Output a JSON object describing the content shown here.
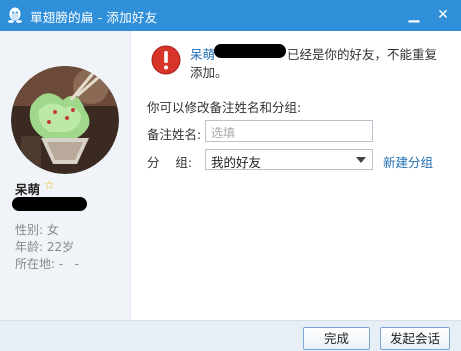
{
  "window": {
    "title": "單翅膀的扁 - 添加好友",
    "controls": {
      "minimize": "▁",
      "close": "✕"
    }
  },
  "profile": {
    "name": "呆萌",
    "gender": "性别: 女",
    "age": "年龄: 22岁",
    "location": "所在地: -   -"
  },
  "message": {
    "nickname": "呆萌",
    "line1_suffix": "已经是你的好友，不能重复",
    "line2": "添加。"
  },
  "form": {
    "hint": "你可以修改备注姓名和分组:",
    "remark_label": "备注姓名:",
    "remark_placeholder": "选填",
    "group_label": "分    组:",
    "group_value": "我的好友",
    "new_group_link": "新建分组"
  },
  "footer": {
    "done_label": "完成",
    "chat_label": "发起会话"
  },
  "colors": {
    "titlebar": "#2f8fd9",
    "link": "#1f6fb5",
    "warning": "#d8352a"
  }
}
